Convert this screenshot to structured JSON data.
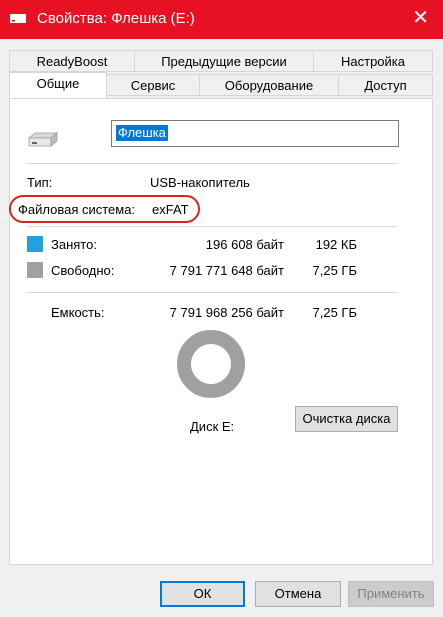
{
  "window": {
    "title": "Свойства: Флешка (E:)",
    "close_glyph": "✕"
  },
  "tabs": {
    "row1": [
      "ReadyBoost",
      "Предыдущие версии",
      "Настройка"
    ],
    "row2": [
      "Общие",
      "Сервис",
      "Оборудование",
      "Доступ"
    ],
    "active": "Общие"
  },
  "general": {
    "name_value": "Флешка",
    "type_label": "Тип:",
    "type_value": "USB-накопитель",
    "fs_label": "Файловая система:",
    "fs_value": "exFAT",
    "used_label": "Занято:",
    "used_bytes": "196 608 байт",
    "used_short": "192 КБ",
    "free_label": "Свободно:",
    "free_bytes": "7 791 771 648 байт",
    "free_short": "7,25 ГБ",
    "capacity_label": "Емкость:",
    "capacity_bytes": "7 791 968 256 байт",
    "capacity_short": "7,25 ГБ",
    "disk_label": "Диск E:",
    "cleanup_button": "Очистка диска",
    "used_fraction": 2.52e-05
  },
  "colors": {
    "used": "#26a0da",
    "free": "#a0a0a0",
    "accent": "#e81123",
    "highlight": "#e0201c"
  },
  "buttons": {
    "ok": "ОК",
    "cancel": "Отмена",
    "apply": "Применить"
  }
}
